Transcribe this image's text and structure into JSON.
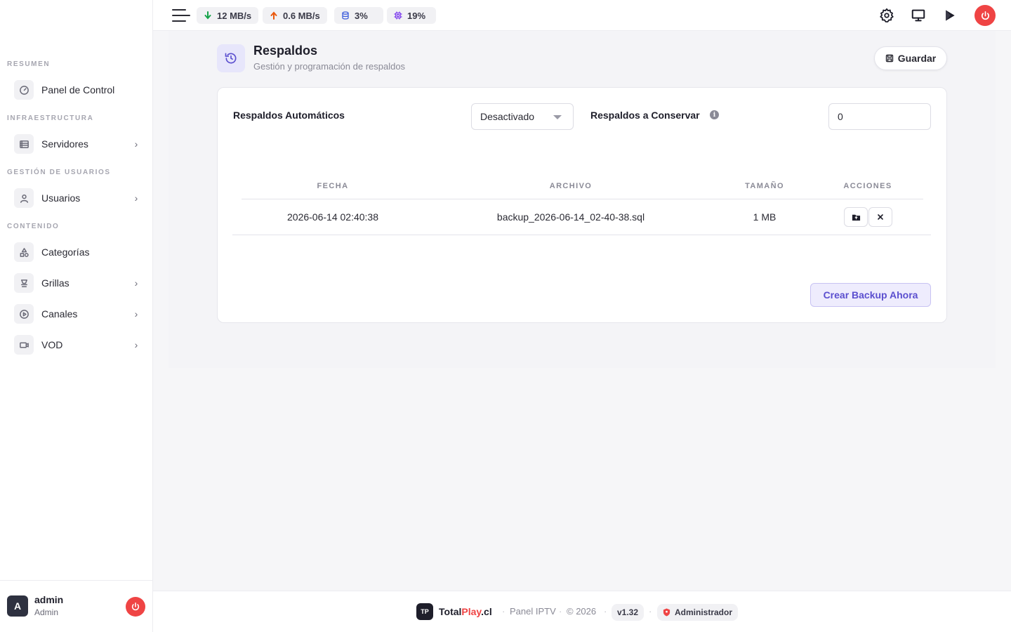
{
  "topbar": {
    "stats": {
      "download": "12 MB/s",
      "upload": "0.6 MB/s",
      "disk": "3%",
      "cpu": "19%"
    },
    "icons": [
      "gear-icon",
      "monitor-icon",
      "play-icon",
      "power-icon"
    ]
  },
  "sidebar": {
    "sections": {
      "resumen": "RESUMEN",
      "infraestructura": "INFRAESTRUCTURA",
      "usuarios": "GESTIÓN DE USUARIOS",
      "contenido": "CONTENIDO"
    },
    "items": [
      {
        "label": "Panel de Control",
        "icon": "gauge-icon"
      },
      {
        "label": "Servidores",
        "icon": "server-icon"
      },
      {
        "label": "Usuarios",
        "icon": "user-icon"
      },
      {
        "label": "Categorías",
        "icon": "shapes-icon"
      },
      {
        "label": "Grillas",
        "icon": "grid-icon"
      },
      {
        "label": "Canales",
        "icon": "play-circle-icon"
      },
      {
        "label": "VOD",
        "icon": "video-icon"
      }
    ],
    "user": {
      "initial": "A",
      "name": "admin",
      "role": "Admin"
    }
  },
  "page": {
    "title": "Respaldos",
    "subtitle": "Gestión y programación de respaldos",
    "save_label": "Guardar"
  },
  "settings": {
    "auto_label": "Respaldos Automáticos",
    "auto_value": "Desactivado",
    "keep_label": "Respaldos a Conservar",
    "keep_value": "0",
    "info_glyph": "i"
  },
  "table": {
    "headers": [
      "FECHA",
      "ARCHIVO",
      "TAMAÑO",
      "ACCIONES"
    ],
    "rows": [
      {
        "fecha": "2026-06-14 02:40:38",
        "archivo": "backup_2026-06-14_02-40-38.sql",
        "tamano": "1 MB"
      }
    ]
  },
  "create_label": "Crear Backup Ahora",
  "footer": {
    "logo": "TP",
    "brand_a": "Total",
    "brand_b": "Play",
    "brand_c": ".cl",
    "panel": "Panel IPTV",
    "copyright": "© 2026",
    "version": "v1.32",
    "role": "Administrador"
  },
  "colors": {
    "accent": "#5b4fcf",
    "danger": "#ef4444"
  }
}
